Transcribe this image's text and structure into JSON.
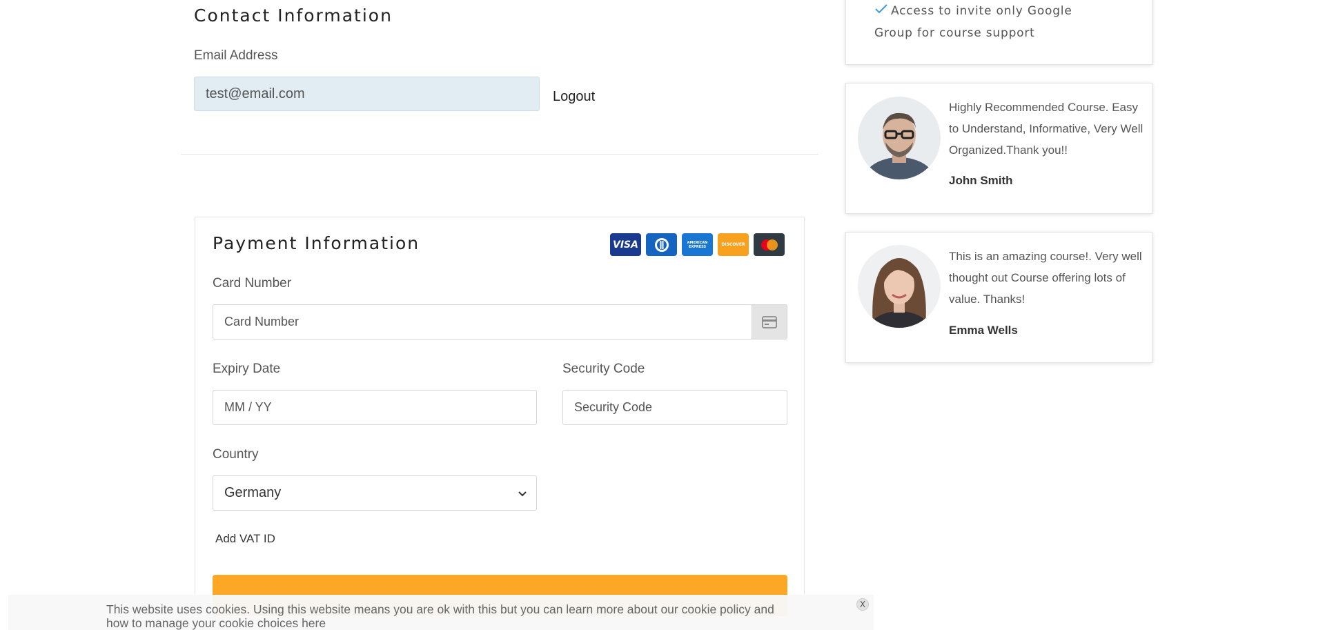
{
  "contact": {
    "title": "Contact Information",
    "email_label": "Email Address",
    "email_value": "test@email.com",
    "logout_label": "Logout"
  },
  "payment": {
    "title": "Payment Information",
    "card_brands": [
      {
        "name": "visa-icon",
        "label": "VISA",
        "color": "#1a3a8f"
      },
      {
        "name": "diners-club-icon",
        "label": "",
        "color": "#1565c0"
      },
      {
        "name": "american-express-icon",
        "label": "AMERICAN EXPRESS",
        "color": "#1976d2"
      },
      {
        "name": "discover-icon",
        "label": "DISCOVER",
        "color": "#f7a11f"
      },
      {
        "name": "mastercard-icon",
        "label": "",
        "color": "#2f3a43"
      }
    ],
    "card_number_label": "Card Number",
    "card_number_placeholder": "Card Number",
    "expiry_label": "Expiry Date",
    "expiry_placeholder": "MM / YY",
    "security_label": "Security Code",
    "security_placeholder": "Security Code",
    "country_label": "Country",
    "country_value": "Germany",
    "add_vat_label": "Add VAT ID",
    "submit_color": "#fca726"
  },
  "sidebar": {
    "feature_text": "Access to invite only Google Group for course support",
    "check_color": "#3a9bd9",
    "reviews": [
      {
        "text": "Highly Recommended Course. Easy to Understand, Informative, Very Well Organized.Thank you!!",
        "author": "John Smith"
      },
      {
        "text": "This is an amazing course!. Very well thought out Course offering lots of value. Thanks!",
        "author": "Emma Wells"
      }
    ]
  },
  "cookie": {
    "text": "This website uses cookies. Using this website means you are ok with this but you can learn more about our cookie policy and how to manage your cookie choices here",
    "close_label": "X"
  }
}
